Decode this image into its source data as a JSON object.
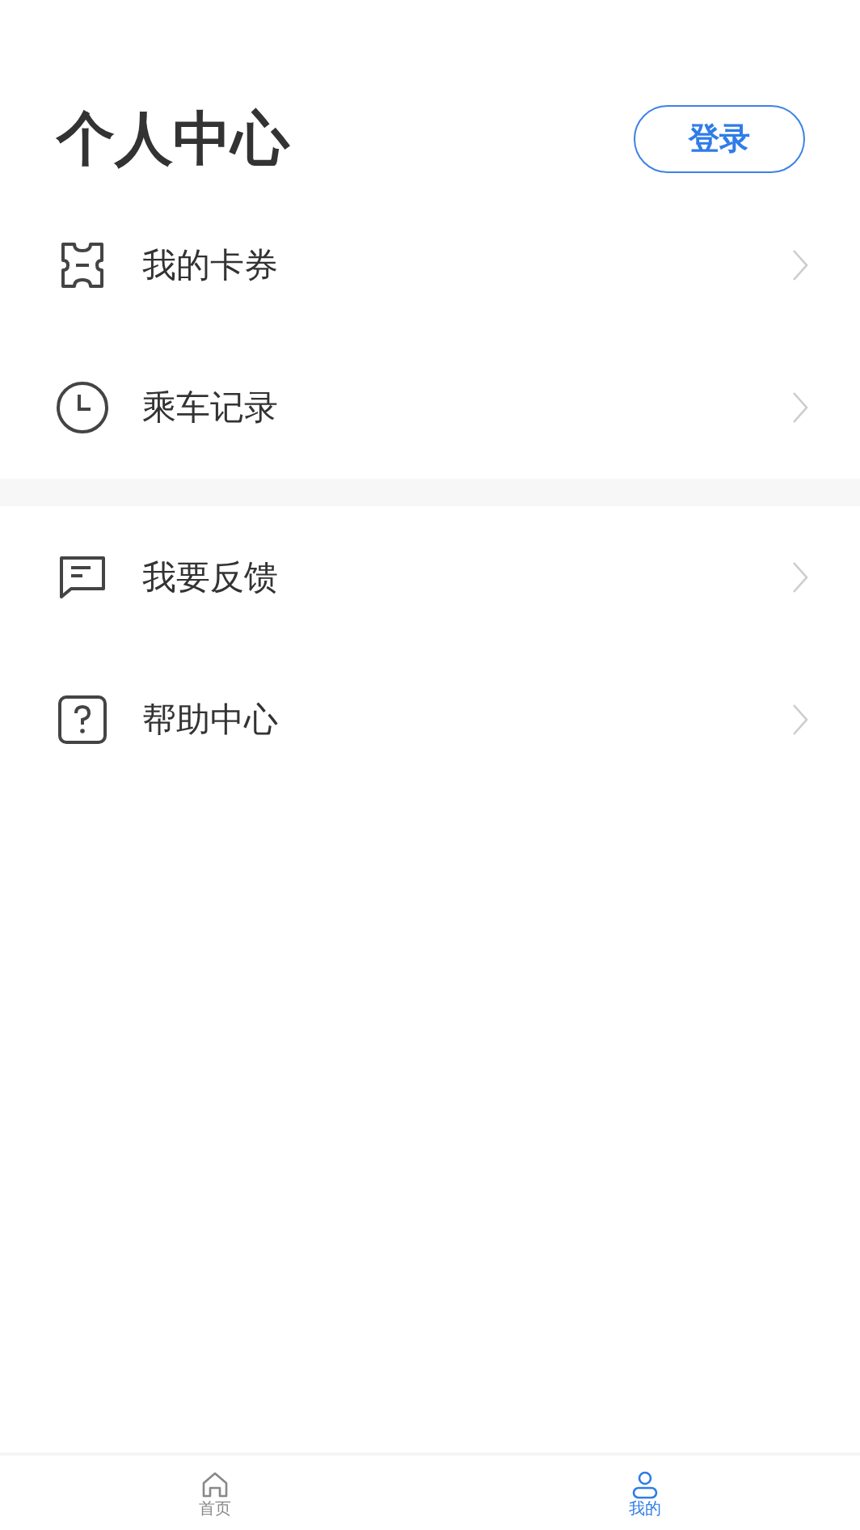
{
  "header": {
    "title": "个人中心",
    "login_button": "登录"
  },
  "sections": [
    {
      "items": [
        {
          "kind": "ticket",
          "label": "我的卡券"
        },
        {
          "kind": "clock",
          "label": "乘车记录"
        }
      ]
    },
    {
      "items": [
        {
          "kind": "chat",
          "label": "我要反馈"
        },
        {
          "kind": "help",
          "label": "帮助中心"
        }
      ]
    }
  ],
  "tabs": [
    {
      "kind": "home",
      "label": "首页",
      "selected": false
    },
    {
      "kind": "person",
      "label": "我的",
      "selected": true
    }
  ]
}
